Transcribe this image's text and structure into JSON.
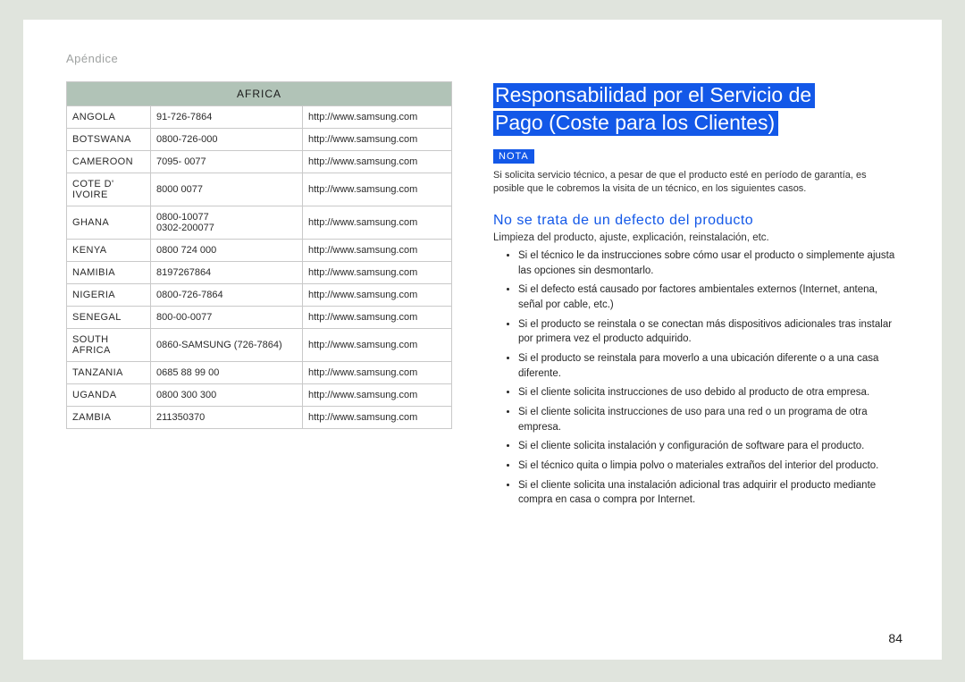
{
  "section_label": "Apéndice",
  "page_number": "84",
  "table": {
    "header": "AFRICA",
    "rows": [
      {
        "country": "ANGOLA",
        "phone": "91-726-7864",
        "url": "http://www.samsung.com"
      },
      {
        "country": "BOTSWANA",
        "phone": "0800-726-000",
        "url": "http://www.samsung.com"
      },
      {
        "country": "CAMEROON",
        "phone": "7095- 0077",
        "url": "http://www.samsung.com"
      },
      {
        "country": "COTE D' IVOIRE",
        "phone": "8000 0077",
        "url": "http://www.samsung.com"
      },
      {
        "country": "GHANA",
        "phone": "0800-10077\n0302-200077",
        "url": "http://www.samsung.com"
      },
      {
        "country": "KENYA",
        "phone": "0800 724 000",
        "url": "http://www.samsung.com"
      },
      {
        "country": "NAMIBIA",
        "phone": "8197267864",
        "url": "http://www.samsung.com"
      },
      {
        "country": "NIGERIA",
        "phone": "0800-726-7864",
        "url": "http://www.samsung.com"
      },
      {
        "country": "SENEGAL",
        "phone": "800-00-0077",
        "url": "http://www.samsung.com"
      },
      {
        "country": "SOUTH AFRICA",
        "phone": "0860-SAMSUNG (726-7864)",
        "url": "http://www.samsung.com"
      },
      {
        "country": "TANZANIA",
        "phone": "0685 88 99 00",
        "url": "http://www.samsung.com"
      },
      {
        "country": "UGANDA",
        "phone": "0800 300 300",
        "url": "http://www.samsung.com"
      },
      {
        "country": "ZAMBIA",
        "phone": "211350370",
        "url": "http://www.samsung.com"
      }
    ]
  },
  "right": {
    "title_line1": "Responsabilidad por el Servicio de",
    "title_line2": "Pago (Coste para los Clientes)",
    "nota_label": "NOTA",
    "nota_text": "Si solicita servicio técnico, a pesar de que el producto esté en período de garantía, es posible que le cobremos la visita de un técnico, en los siguientes casos.",
    "sub_heading": "No se trata de un defecto del producto",
    "lead": "Limpieza del producto, ajuste, explicación, reinstalación, etc.",
    "bullets": [
      "Si el técnico le da instrucciones sobre cómo usar el producto o simplemente ajusta las opciones sin desmontarlo.",
      "Si el defecto está causado por factores ambientales externos (Internet, antena, señal por cable, etc.)",
      "Si el producto se reinstala o se conectan más dispositivos adicionales tras instalar por primera vez el producto adquirido.",
      "Si el producto se reinstala para moverlo a una ubicación diferente o a una casa diferente.",
      "Si el cliente solicita instrucciones de uso debido al producto de otra empresa.",
      "Si el cliente solicita instrucciones de uso para una red o un programa de otra empresa.",
      "Si el cliente solicita instalación y configuración de software para el producto.",
      "Si el técnico quita o limpia polvo o materiales extraños del interior del producto.",
      "Si el cliente solicita una instalación adicional tras adquirir el producto mediante compra en casa o compra por Internet."
    ]
  }
}
